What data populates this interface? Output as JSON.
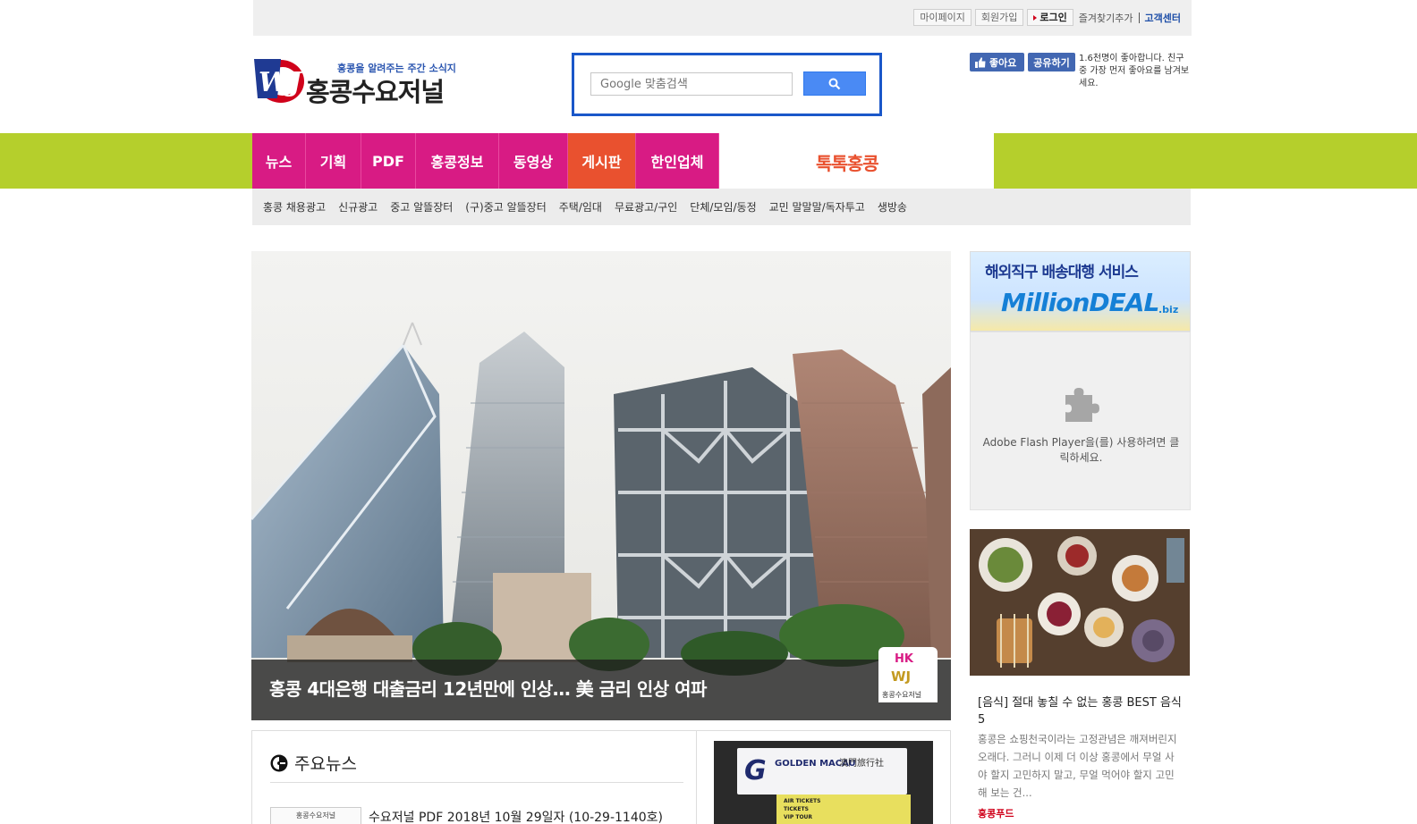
{
  "topbar": {
    "mypage": "마이페이지",
    "signup": "회원가입",
    "login": "로그인",
    "bookmark": "즐겨찾기추가",
    "support": "고객센터"
  },
  "header": {
    "logo_mark": "WJ",
    "tagline": "홍콩을 알려주는 주간 소식지",
    "site_name": "홍콩수요저널"
  },
  "search": {
    "placeholder": "Google 맞춤검색"
  },
  "facebook": {
    "like": "좋아요",
    "share": "공유하기",
    "text": "1.6천명이 좋아합니다. 친구 중 가장 먼저 좋아요를 남겨보세요."
  },
  "nav": {
    "items": [
      "뉴스",
      "기획",
      "PDF",
      "홍콩정보",
      "동영상",
      "게시판",
      "한인업체"
    ],
    "active_index": 5,
    "special": "톡톡홍콩"
  },
  "subnav": {
    "items": [
      "홍콩 채용광고",
      "신규광고",
      "중고 알뜰장터",
      "(구)중고 알뜰장터",
      "주택/임대",
      "무료광고/구인",
      "단체/모임/동정",
      "교민 말말말/독자투고",
      "생방송"
    ]
  },
  "hero": {
    "caption": "홍콩 4대은행 대출금리 12년만에 인상… 美 금리 인상 여파",
    "badge_top": "HK",
    "badge_mid": "WJ",
    "badge_bottom": "홍콩수요저널"
  },
  "ad": {
    "line1": "해외직구 배송대행 서비스",
    "line2": "MillionDEAL",
    "line3": ".biz"
  },
  "flash": {
    "message": "Adobe Flash Player을(를) 사용하려면 클릭하세요."
  },
  "food": {
    "title": "[음식] 절대 놓칠 수 없는 홍콩 BEST 음식 5",
    "description": "홍콩은 쇼핑천국이라는 고정관념은 깨져버린지 오래다. 그러니 이제 더 이상 홍콩에서 무얼 사야 할지 고민하지 말고, 무얼 먹어야 할지 고민해 보는 건...",
    "category": "홍콩푸드"
  },
  "news": {
    "heading": "주요뉴스",
    "first_headline": "수요저널 PDF 2018년 10월 29일자 (10-29-1140호)",
    "thumb_text": "홍콩수요저널"
  },
  "golden_macau": {
    "logo": "G",
    "name_en": "GOLDEN MACAU",
    "name_cn": "澳門旅行社",
    "panel": [
      "AIR TICKETS",
      "TICKETS",
      "VIP TOUR"
    ]
  },
  "colors": {
    "nav_magenta": "#d81b84",
    "nav_active": "#e9512f",
    "band_green": "#b5cf2c",
    "search_blue": "#1a57c9",
    "facebook_blue": "#4267b2"
  }
}
